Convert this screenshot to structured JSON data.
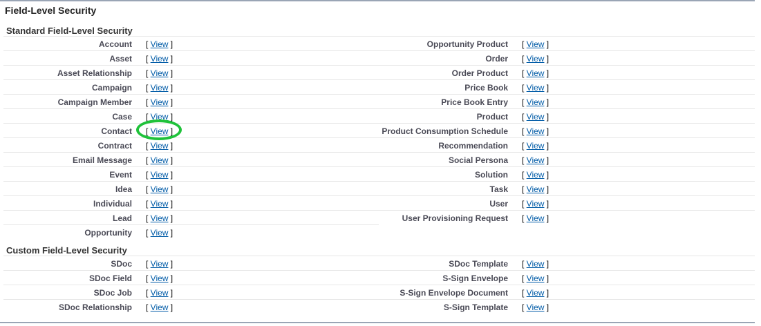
{
  "title": "Field-Level Security",
  "link_text": "View",
  "bracket_open": "[ ",
  "bracket_close": " ]",
  "standard": {
    "heading": "Standard Field-Level Security",
    "left": [
      "Account",
      "Asset",
      "Asset Relationship",
      "Campaign",
      "Campaign Member",
      "Case",
      "Contact",
      "Contract",
      "Email Message",
      "Event",
      "Idea",
      "Individual",
      "Lead",
      "Opportunity"
    ],
    "right": [
      "Opportunity Product",
      "Order",
      "Order Product",
      "Price Book",
      "Price Book Entry",
      "Product",
      "Product Consumption Schedule",
      "Recommendation",
      "Social Persona",
      "Solution",
      "Task",
      "User",
      "User Provisioning Request"
    ]
  },
  "custom": {
    "heading": "Custom Field-Level Security",
    "left": [
      "SDoc",
      "SDoc Field",
      "SDoc Job",
      "SDoc Relationship"
    ],
    "right": [
      "SDoc Template",
      "S-Sign Envelope",
      "S-Sign Envelope Document",
      "S-Sign Template"
    ]
  },
  "highlight": {
    "target": "Contact",
    "color": "#1fc23a"
  }
}
